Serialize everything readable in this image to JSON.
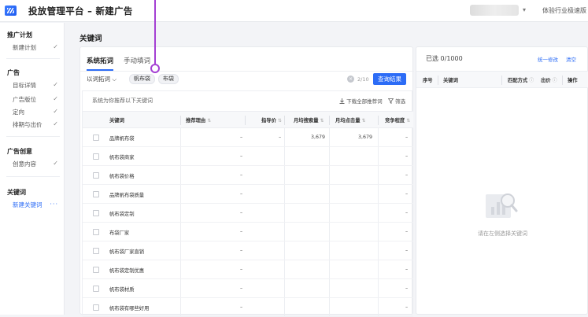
{
  "header": {
    "app_title": "投放管理平台 – 新建广告",
    "user_caret": "▾",
    "version_label": "体验行业极速版"
  },
  "sidebar": {
    "groups": [
      {
        "title": "推广计划",
        "items": [
          {
            "label": "新建计划",
            "mark": "✓"
          }
        ]
      },
      {
        "title": "广告",
        "items": [
          {
            "label": "目标详情",
            "mark": "✓"
          },
          {
            "label": "广告版位",
            "mark": "✓"
          },
          {
            "label": "定向",
            "mark": "✓"
          },
          {
            "label": "排期与出价",
            "mark": "✓"
          }
        ]
      },
      {
        "title": "广告创意",
        "items": [
          {
            "label": "创意内容",
            "mark": "✓"
          }
        ]
      },
      {
        "title": "关键词",
        "items": [
          {
            "label": "新建关键词",
            "mark": "···",
            "active": true
          }
        ]
      }
    ]
  },
  "main": {
    "title": "关键词",
    "tabs": [
      {
        "label": "系统拓词",
        "active": true
      },
      {
        "label": "手动填词",
        "active": false
      }
    ],
    "expand_select": "以词拓词 ⌵",
    "chips": [
      "帆布袋",
      "布袋"
    ],
    "clear_icon": "×",
    "count_text": "2/10",
    "query_button": "查询结果",
    "hint_text": "系统为你推荐以下关键词",
    "download_label": "下载全部推荐词",
    "filter_label": "筛选",
    "columns": [
      {
        "label": "关键词",
        "sort": ""
      },
      {
        "label": "推荐理由",
        "sort": "⇅"
      },
      {
        "label": "指导价",
        "sort": "⇅"
      },
      {
        "label": "月均搜索量",
        "sort": "⇅"
      },
      {
        "label": "月均点击量",
        "sort": "⇅"
      },
      {
        "label": "竞争程度",
        "sort": "⇅"
      }
    ],
    "rows": [
      {
        "keyword": "品牌帆布袋",
        "reason": "–",
        "price": "–",
        "search": "3,679",
        "clicks": "3,679",
        "competition": "–"
      },
      {
        "keyword": "帆布袋商家",
        "reason": "–",
        "price": "",
        "search": "",
        "clicks": "",
        "competition": "–"
      },
      {
        "keyword": "帆布袋价格",
        "reason": "–",
        "price": "",
        "search": "",
        "clicks": "",
        "competition": "–"
      },
      {
        "keyword": "品牌帆布袋质量",
        "reason": "–",
        "price": "",
        "search": "",
        "clicks": "",
        "competition": "–"
      },
      {
        "keyword": "帆布袋定制",
        "reason": "–",
        "price": "",
        "search": "",
        "clicks": "",
        "competition": "–"
      },
      {
        "keyword": "布袋厂家",
        "reason": "–",
        "price": "",
        "search": "",
        "clicks": "",
        "competition": "–"
      },
      {
        "keyword": "帆布袋厂家直销",
        "reason": "–",
        "price": "",
        "search": "",
        "clicks": "",
        "competition": "–"
      },
      {
        "keyword": "帆布袋定制优惠",
        "reason": "–",
        "price": "",
        "search": "",
        "clicks": "",
        "competition": "–"
      },
      {
        "keyword": "帆布袋材质",
        "reason": "–",
        "price": "",
        "search": "",
        "clicks": "",
        "competition": "–"
      },
      {
        "keyword": "帆布袋有哪些好用",
        "reason": "–",
        "price": "",
        "search": "",
        "clicks": "",
        "competition": "–"
      }
    ]
  },
  "selected": {
    "count_text": "已选 0/1000",
    "edit_link": "统一修改",
    "clear_link": "清空",
    "columns": [
      {
        "label": "序号",
        "sort": ""
      },
      {
        "label": "关键词",
        "sort": ""
      },
      {
        "label": "匹配方式",
        "sort": "ⓘ"
      },
      {
        "label": "出价",
        "sort": "ⓘ"
      },
      {
        "label": "操作",
        "sort": ""
      }
    ],
    "empty_text": "请在左侧选择关键词"
  },
  "colors": {
    "accent": "#2c6cf6",
    "annotation": "#a43fd3",
    "background": "#f3f4f7"
  }
}
